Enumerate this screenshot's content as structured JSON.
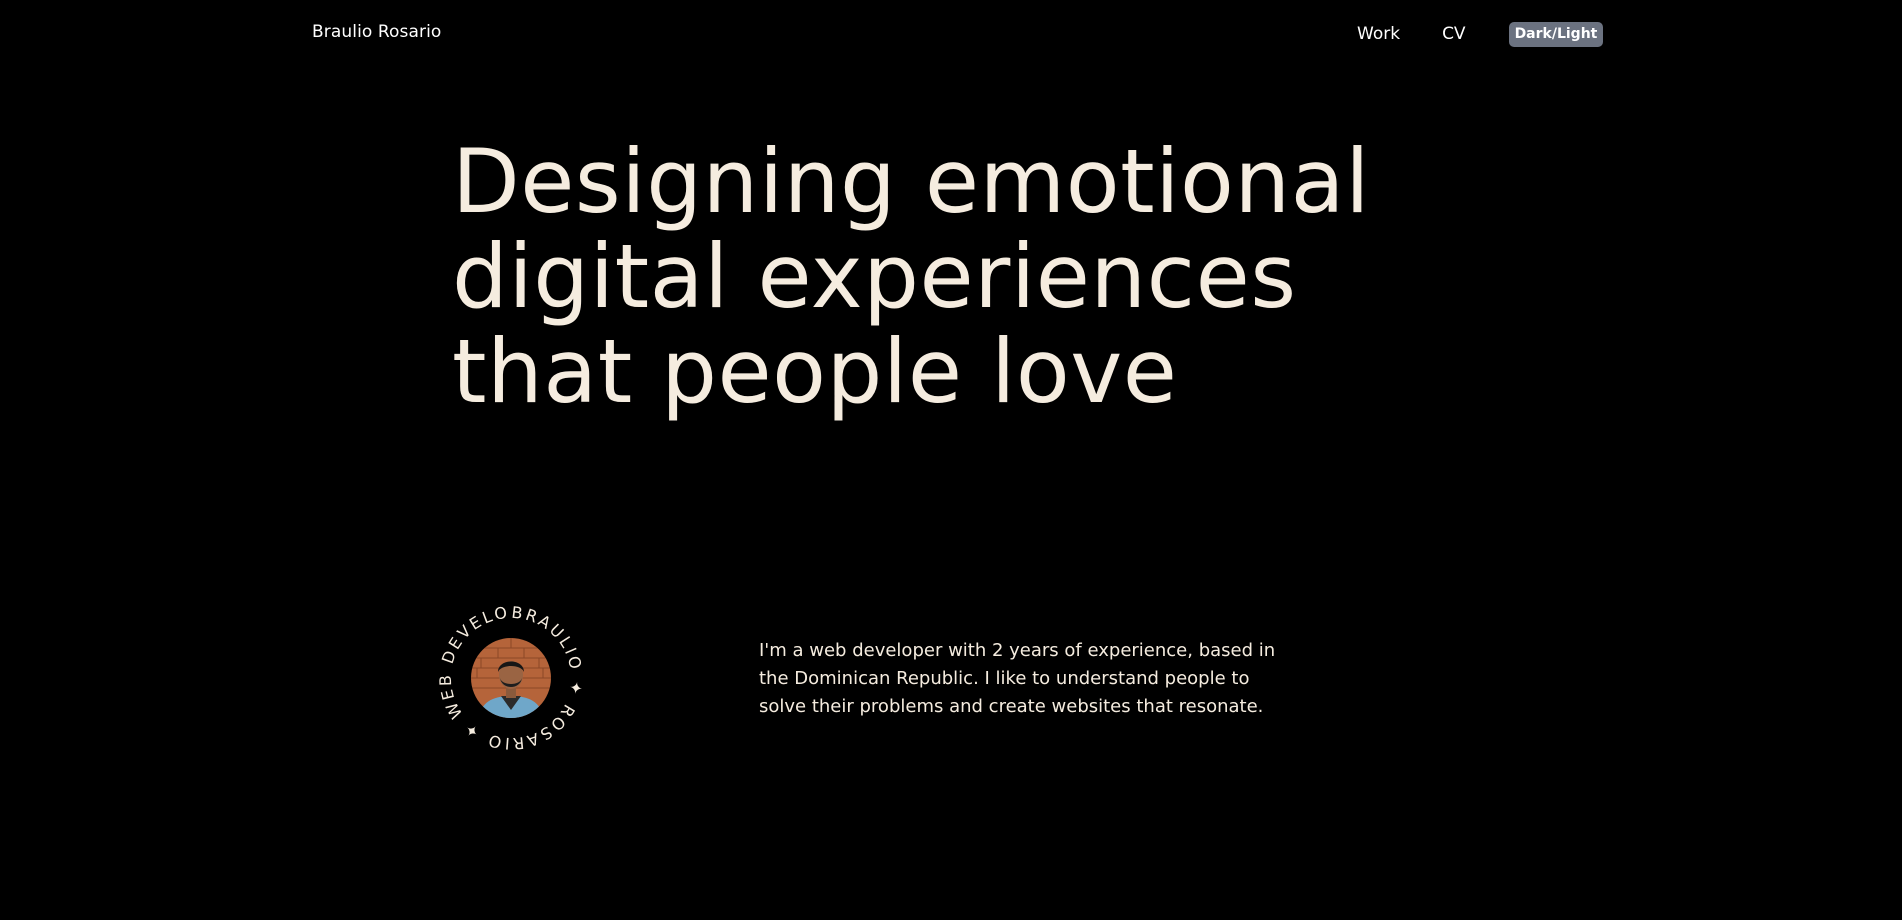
{
  "nav": {
    "brand": "Braulio Rosario",
    "links": [
      "Work",
      "CV"
    ],
    "toggle_label": "Dark/Light"
  },
  "hero": {
    "lines": [
      "Designing emotional",
      "digital experiences",
      "that people love"
    ]
  },
  "badge": {
    "circular_text": "BRAULIO ✦ ROSARIO ✦ WEB DEVELOPER ✦"
  },
  "intro": {
    "text": "I'm a web developer with 2 years of experience, based in the Dominican Republic. I like to understand people to solve their problems and create websites that resonate."
  },
  "colors": {
    "background": "#000000",
    "text": "#f5ecdf",
    "toggle_bg": "#6b7280"
  }
}
